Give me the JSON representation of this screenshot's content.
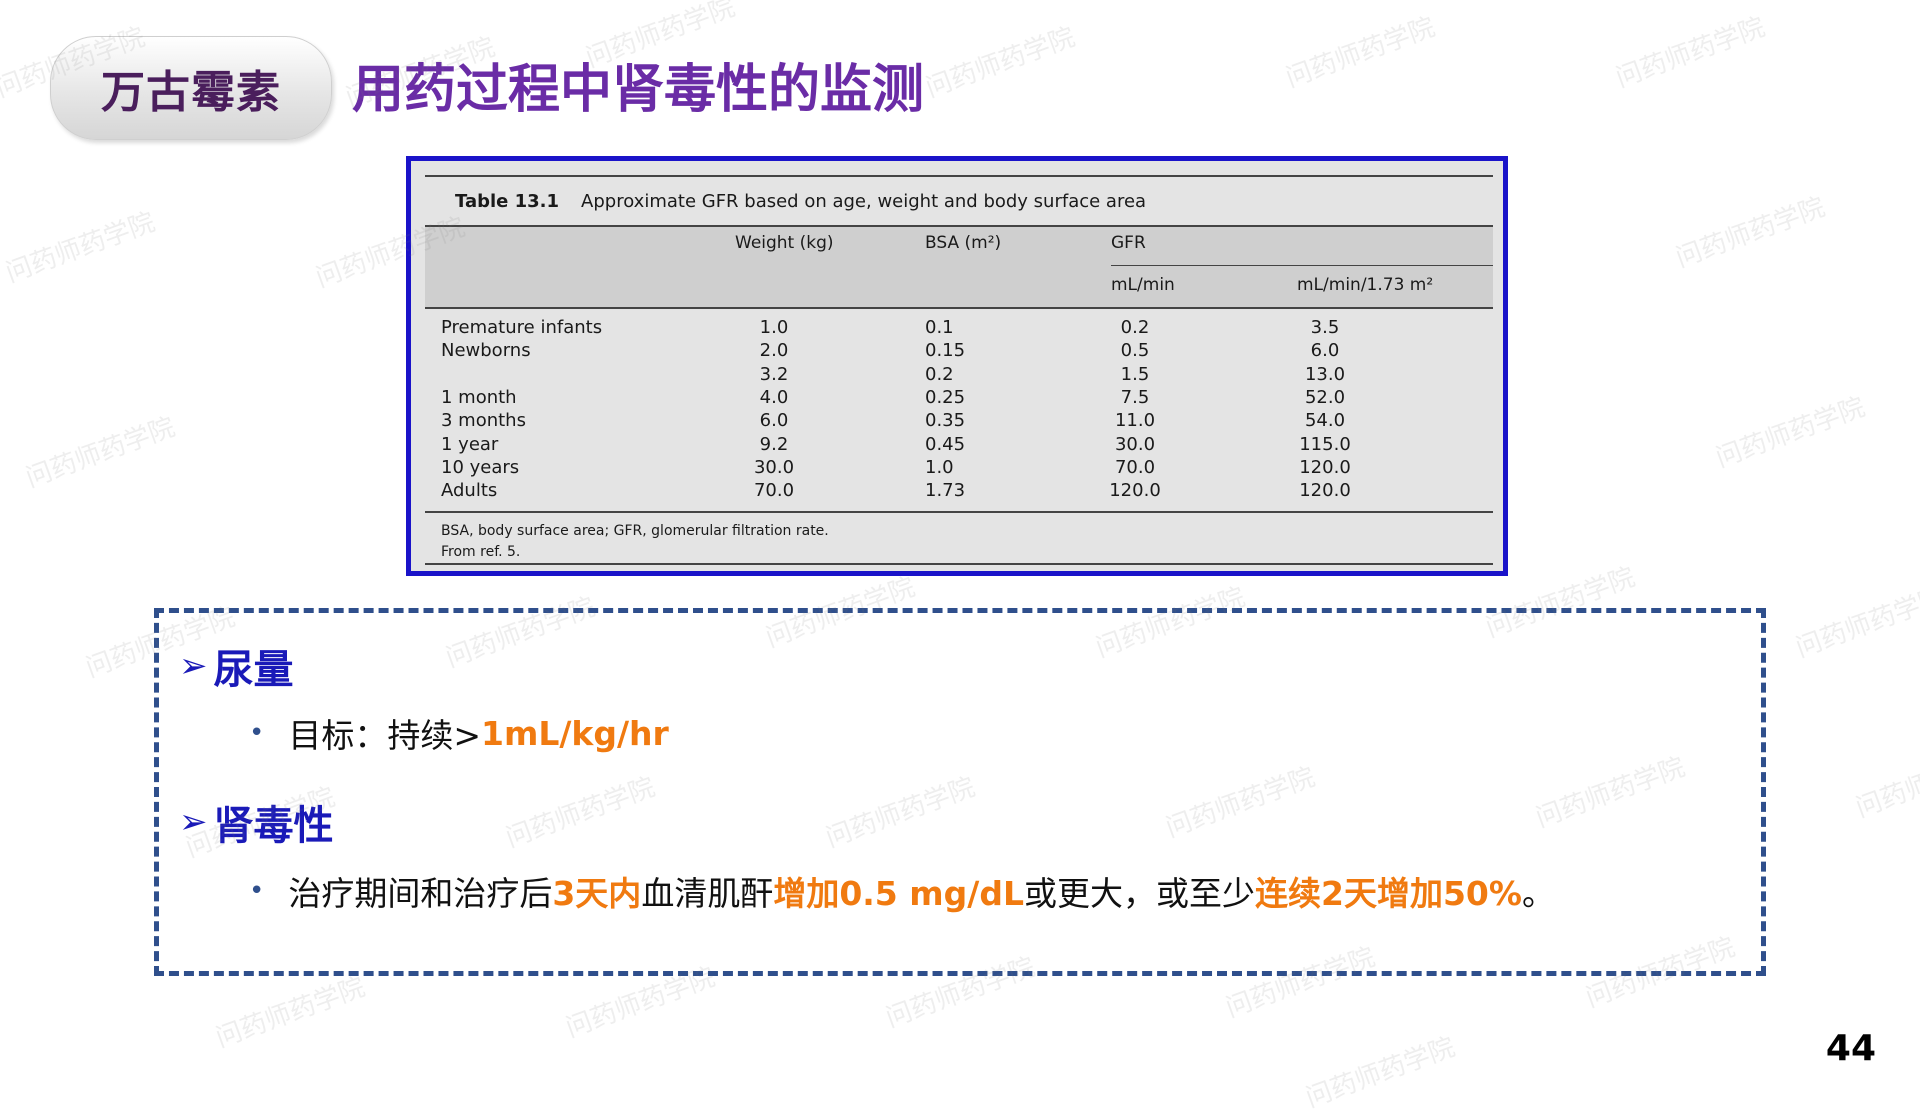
{
  "header": {
    "tag": "万古霉素",
    "title": "用药过程中肾毒性的监测"
  },
  "table": {
    "caption_num": "Table 13.1",
    "caption_text": "Approximate GFR based on age, weight and body surface area",
    "col_weight": "Weight (kg)",
    "col_bsa": "BSA (m²)",
    "col_gfr": "GFR",
    "sub_mlmin": "mL/min",
    "sub_mlmin173": "mL/min/1.73 m²",
    "rows": [
      {
        "label": "Premature infants",
        "weight": "1.0",
        "bsa": "0.1",
        "gfr": "0.2",
        "gfr173": "3.5"
      },
      {
        "label": "Newborns",
        "weight": "2.0",
        "bsa": "0.15",
        "gfr": "0.5",
        "gfr173": "6.0"
      },
      {
        "label": "",
        "weight": "3.2",
        "bsa": "0.2",
        "gfr": "1.5",
        "gfr173": "13.0"
      },
      {
        "label": "1 month",
        "weight": "4.0",
        "bsa": "0.25",
        "gfr": "7.5",
        "gfr173": "52.0"
      },
      {
        "label": "3 months",
        "weight": "6.0",
        "bsa": "0.35",
        "gfr": "11.0",
        "gfr173": "54.0"
      },
      {
        "label": "1 year",
        "weight": "9.2",
        "bsa": "0.45",
        "gfr": "30.0",
        "gfr173": "115.0"
      },
      {
        "label": "10 years",
        "weight": "30.0",
        "bsa": "1.0",
        "gfr": "70.0",
        "gfr173": "120.0"
      },
      {
        "label": "Adults",
        "weight": "70.0",
        "bsa": "1.73",
        "gfr": "120.0",
        "gfr173": "120.0"
      }
    ],
    "footnote1": "BSA, body surface area; GFR, glomerular filtration rate.",
    "footnote2": "From ref. 5."
  },
  "content": {
    "section1": "尿量",
    "bullet1_prefix": "目标：持续>",
    "bullet1_hl": "1mL/kg/hr",
    "section2": "肾毒性",
    "bullet2_a": "治疗期间和治疗后",
    "bullet2_hl1": "3天内",
    "bullet2_b": "血清肌酐",
    "bullet2_hl2": "增加0.5 mg/dL",
    "bullet2_c": "或更大，或至少",
    "bullet2_hl3": "连续2天增加50%",
    "bullet2_d": "。",
    "arrow_icon": "➢",
    "bullet_icon": "•"
  },
  "watermark_text": "问药师药学院",
  "page_number": "44",
  "colors": {
    "title": "#6a2ca6",
    "heading": "#1a1ab8",
    "highlight": "#f07a10",
    "table_border": "#1a13c9",
    "dash_border": "#2f4f8c"
  }
}
